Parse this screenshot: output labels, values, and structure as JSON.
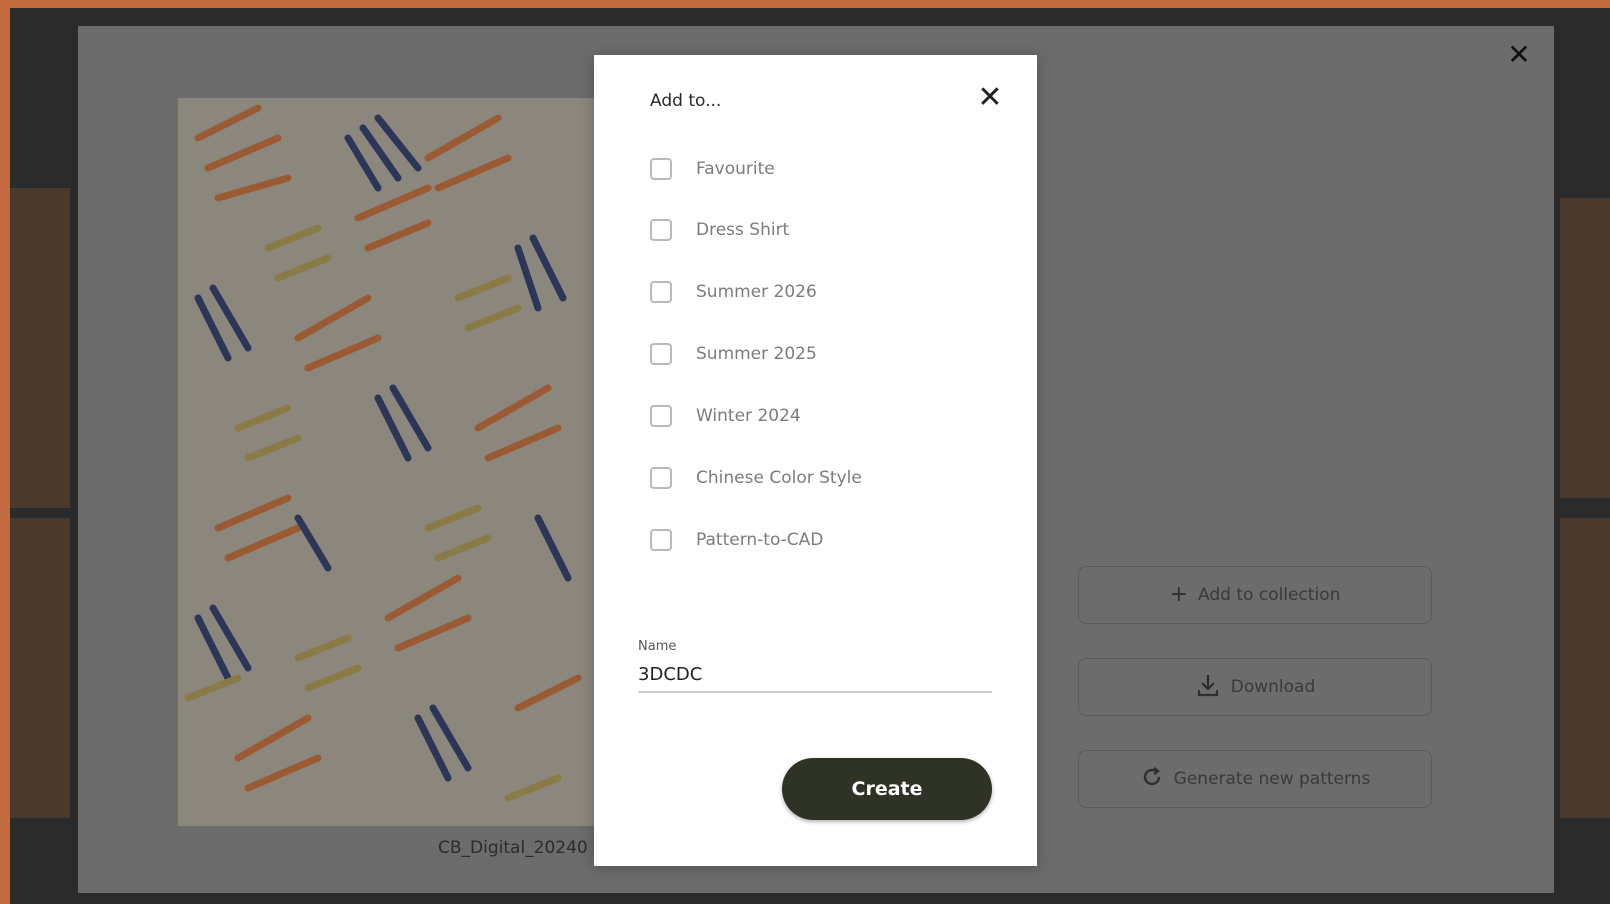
{
  "viewer": {
    "close_icon": "close-icon",
    "caption": "CB_Digital_20240",
    "actions": {
      "add_to_collection": "Add to collection",
      "download": "Download",
      "generate": "Generate new patterns"
    }
  },
  "modal": {
    "title": "Add to...",
    "close_icon": "close-icon",
    "options": [
      {
        "label": "Favourite",
        "checked": false
      },
      {
        "label": "Dress Shirt",
        "checked": false
      },
      {
        "label": "Summer 2026",
        "checked": false
      },
      {
        "label": "Summer 2025",
        "checked": false
      },
      {
        "label": "Winter 2024",
        "checked": false
      },
      {
        "label": "Chinese Color Style",
        "checked": false
      },
      {
        "label": "Pattern-to-CAD",
        "checked": false
      }
    ],
    "name_label": "Name",
    "name_value": "3DCDC",
    "create_label": "Create"
  },
  "colors": {
    "accent": "#2e3325",
    "frame": "#c46a3f",
    "overlay": "#6c6c6c"
  }
}
